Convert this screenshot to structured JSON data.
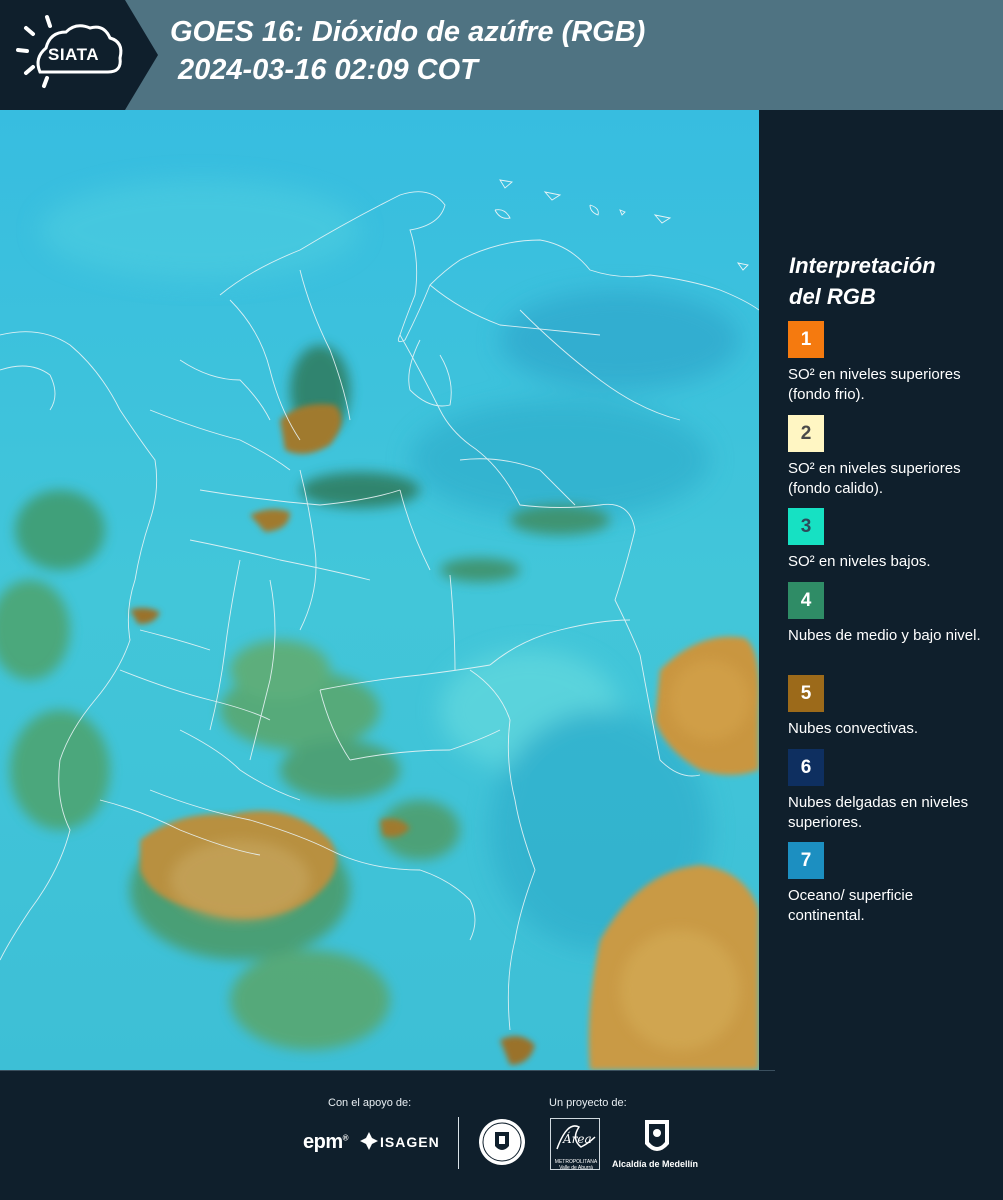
{
  "header": {
    "logo_text": "SIATA",
    "title_line1": "GOES 16: Dióxido de azúfre (RGB)",
    "title_line2": "2024-03-16 02:09 COT"
  },
  "legend": {
    "title_line1": "Interpretación",
    "title_line2": "del RGB",
    "items": [
      {
        "number": "1",
        "color": "#f57a0f",
        "text_color": "#ffffff",
        "label": "SO² en niveles superiores (fondo frio)."
      },
      {
        "number": "2",
        "color": "#fff6c3",
        "text_color": "#4a4a4a",
        "label": "SO² en niveles superiores (fondo calido)."
      },
      {
        "number": "3",
        "color": "#16e1c3",
        "text_color": "#2d4a5a",
        "label": "SO² en niveles bajos."
      },
      {
        "number": "4",
        "color": "#2f8c66",
        "text_color": "#ffffff",
        "label": "Nubes de medio y bajo nivel."
      },
      {
        "number": "5",
        "color": "#9c6a1a",
        "text_color": "#ffffff",
        "label": "Nubes convectivas."
      },
      {
        "number": "6",
        "color": "#0e2f60",
        "text_color": "#ffffff",
        "label": "Nubes delgadas en niveles superiores."
      },
      {
        "number": "7",
        "color": "#1c8fc1",
        "text_color": "#ffffff",
        "label": "Oceano/ superficie continental."
      }
    ]
  },
  "footer": {
    "support_label": "Con el apoyo de:",
    "project_label": "Un proyecto de:",
    "epm": "epm",
    "isagen": "ISAGEN",
    "area_name": "Área",
    "area_subtitle_1": "METROPOLITANA",
    "area_subtitle_2": "Valle de Aburrá",
    "alcaldia": "Alcaldía de Medellín"
  },
  "colors": {
    "header_bg": "#4f7382",
    "panel_bg": "#0f1f2c",
    "map_base": "#3ec2d8",
    "convective": "#b58d3c",
    "mid_low_cloud": "#3f9a6a"
  }
}
